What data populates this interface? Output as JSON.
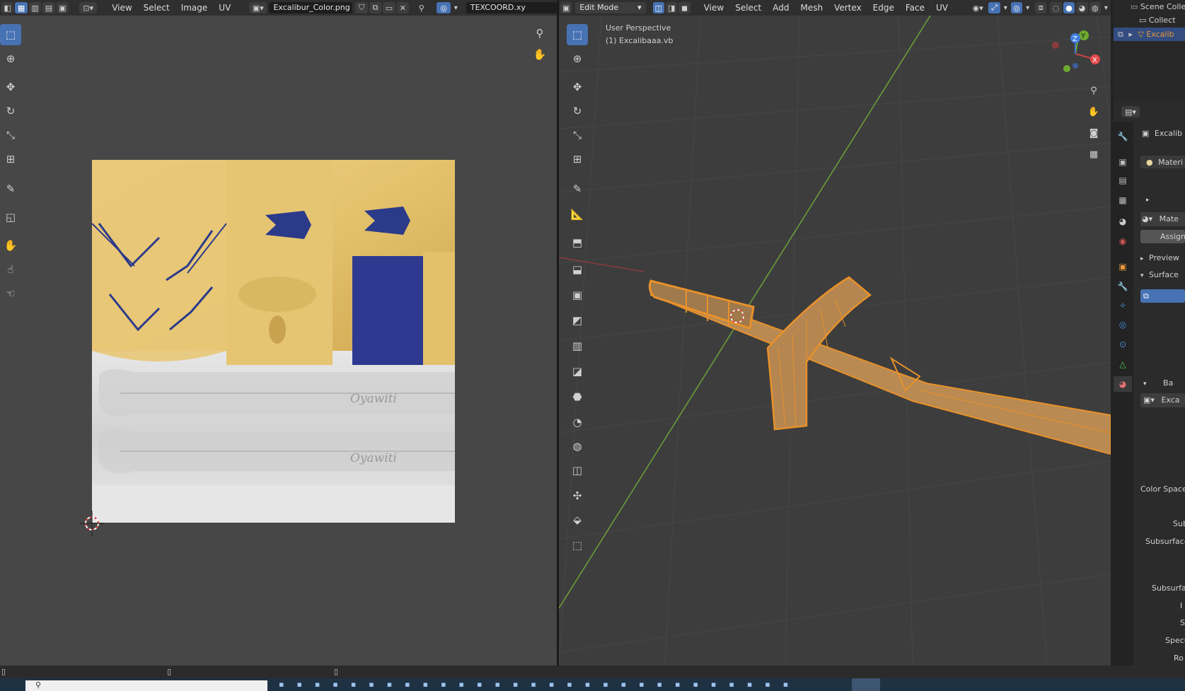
{
  "uv_editor": {
    "menus": [
      "View",
      "Select",
      "Image",
      "UV"
    ],
    "image_name": "Excalibur_Color.png",
    "uv_map": "TEXCOORD.xy",
    "texture": {
      "gold": "#e3c16c",
      "blue": "#2c3a8a",
      "silver": "#d9d9d9",
      "rune_text": "Oyawiti"
    }
  },
  "viewport": {
    "mode": "Edit Mode",
    "menus": [
      "View",
      "Select",
      "Add",
      "Mesh",
      "Vertex",
      "Edge",
      "Face",
      "UV"
    ],
    "overlay_title": "User Perspective",
    "overlay_object": "(1) Excalibaaa.vb",
    "gizmo": {
      "x": "X",
      "y": "Y",
      "z": "Z"
    },
    "mesh_color": "#e8912a"
  },
  "outliner": {
    "rows": [
      "Scene Colle",
      "Collect",
      "Excalib"
    ]
  },
  "properties": {
    "object_name": "Excalib",
    "material_slot": "Materi",
    "material_name": "Mate",
    "assign_label": "Assign",
    "preview_label": "Preview",
    "surface_label": "Surface",
    "base_label": "Ba",
    "texture_name": "Exca",
    "labels": [
      "Color Space",
      "Sub",
      "Subsurface",
      "Subsurfac",
      "I",
      "S",
      "Specu",
      "Ro"
    ]
  }
}
